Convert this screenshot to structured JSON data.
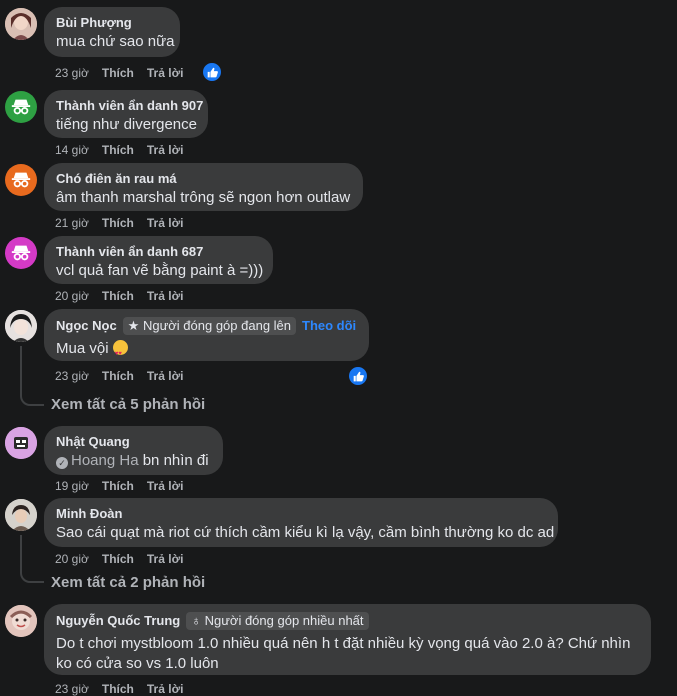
{
  "labels": {
    "like": "Thích",
    "reply": "Trả lời"
  },
  "comments": [
    {
      "author": "Bùi Phượng",
      "text": "mua chứ sao nữa",
      "time": "23 giờ"
    },
    {
      "author": "Thành viên ẩn danh 907",
      "text": "tiếng như divergence",
      "time": "14 giờ"
    },
    {
      "author": "Chó điên ăn rau má",
      "text": "âm thanh marshal trông sẽ ngon hơn outlaw",
      "time": "21 giờ"
    },
    {
      "author": "Thành viên ẩn danh 687",
      "text": "vcl quả fan vẽ bằng paint à =)))",
      "time": "20 giờ"
    },
    {
      "author": "Ngọc Nọc",
      "badge": "Người đóng góp đang lên",
      "follow": "Theo dõi",
      "text": "Mua vội",
      "time": "23 giờ"
    },
    {
      "author": "Nhật Quang",
      "mention": "Hoang Ha",
      "text": " bn nhìn đi",
      "time": "19 giờ"
    },
    {
      "author": "Minh Đoàn",
      "text": "Sao cái quạt mà riot cứ thích cầm kiểu kì lạ vậy, cầm bình thường ko dc ad",
      "time": "20 giờ"
    },
    {
      "author": "Nguyễn Quốc Trung",
      "badge": "Người đóng góp nhiều nhất",
      "text_line1": "Do t chơi mystbloom 1.0 nhiều quá nên h t đặt nhiều kỳ vọng quá vào 2.0 à? Chứ nhìn",
      "text_line2": "ko có cửa so vs 1.0 luôn",
      "time": "23 giờ"
    }
  ],
  "view_more": [
    "Xem tất cả 5 phản hồi",
    "Xem tất cả 2 phản hồi"
  ],
  "colors": {
    "background": "#18191a",
    "bubble": "#3a3b3c",
    "link": "#2d88ff",
    "like": "#1877f2"
  }
}
